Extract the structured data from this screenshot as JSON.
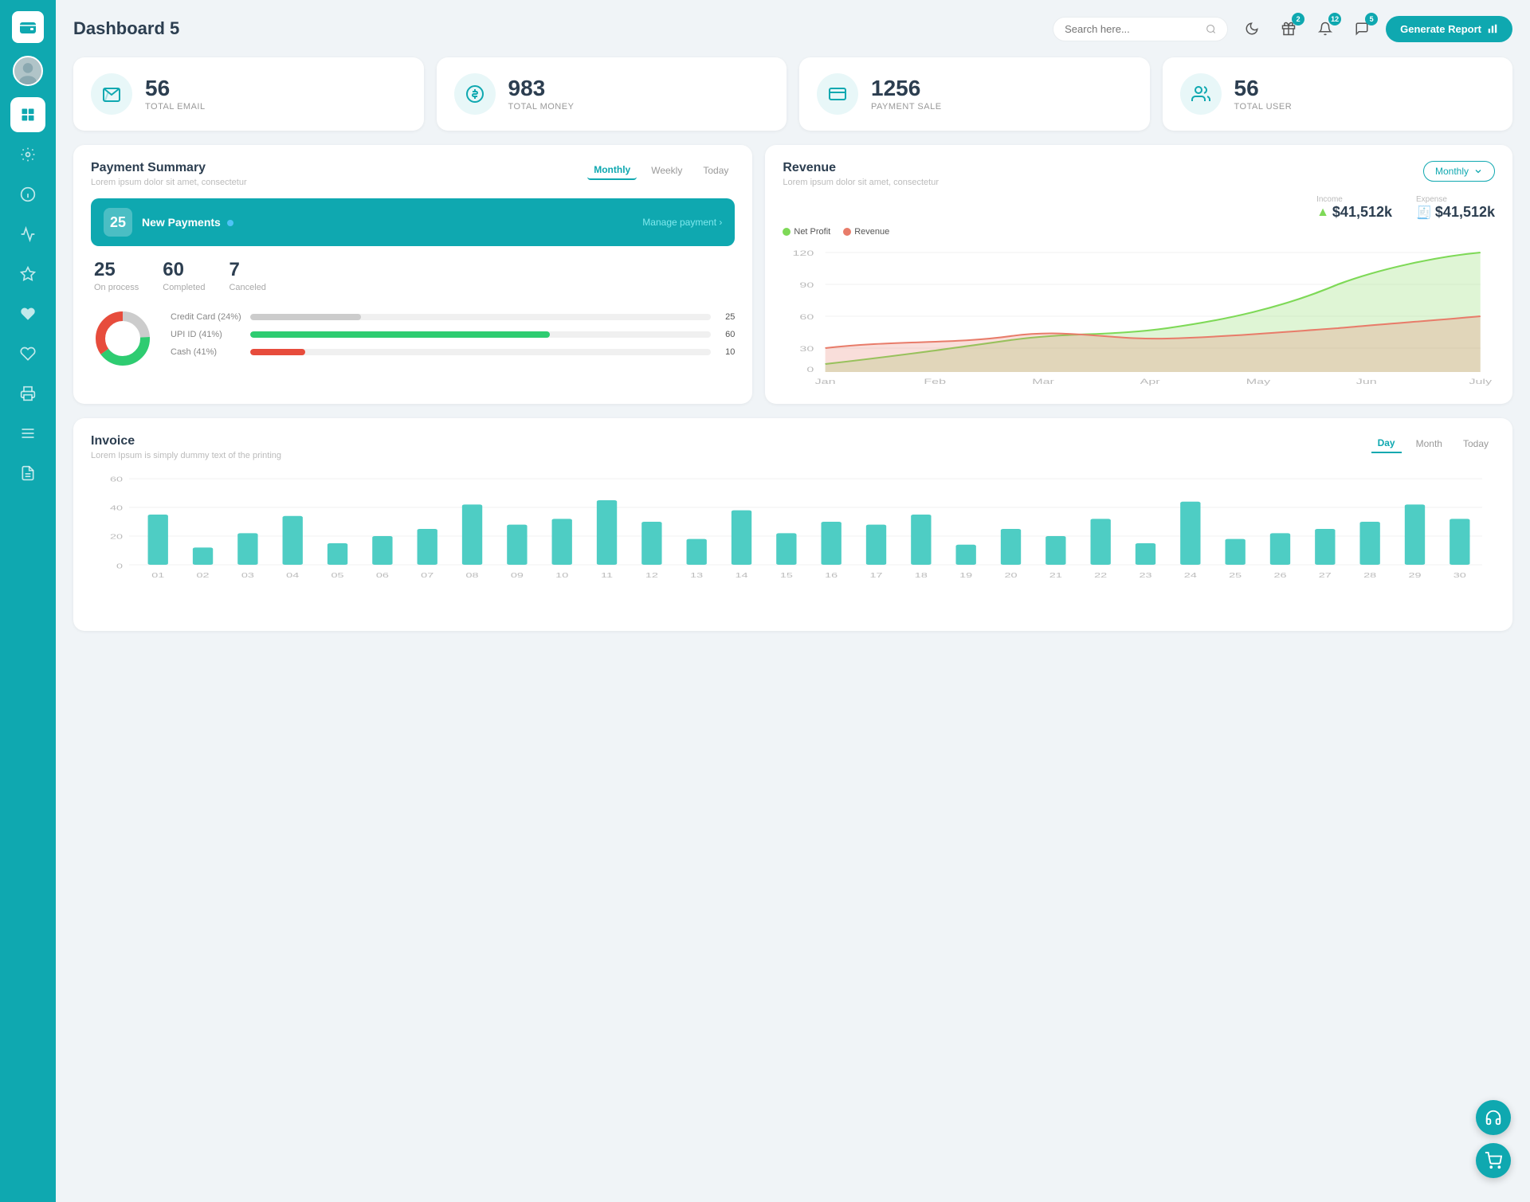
{
  "sidebar": {
    "logo_icon": "wallet",
    "items": [
      {
        "id": "dashboard",
        "icon": "⊞",
        "active": true
      },
      {
        "id": "settings",
        "icon": "⚙"
      },
      {
        "id": "info",
        "icon": "ℹ"
      },
      {
        "id": "chart",
        "icon": "📊"
      },
      {
        "id": "star",
        "icon": "★"
      },
      {
        "id": "heart",
        "icon": "♥"
      },
      {
        "id": "heart2",
        "icon": "♡"
      },
      {
        "id": "print",
        "icon": "🖨"
      },
      {
        "id": "list",
        "icon": "☰"
      },
      {
        "id": "doc",
        "icon": "📋"
      }
    ]
  },
  "header": {
    "title": "Dashboard 5",
    "search_placeholder": "Search here...",
    "badge_gift": "2",
    "badge_bell": "12",
    "badge_chat": "5",
    "generate_btn": "Generate Report"
  },
  "stat_cards": [
    {
      "id": "email",
      "number": "56",
      "label": "TOTAL EMAIL",
      "icon": "📋"
    },
    {
      "id": "money",
      "number": "983",
      "label": "TOTAL MONEY",
      "icon": "$"
    },
    {
      "id": "payment",
      "number": "1256",
      "label": "PAYMENT SALE",
      "icon": "💳"
    },
    {
      "id": "user",
      "number": "56",
      "label": "TOTAL USER",
      "icon": "👥"
    }
  ],
  "payment_summary": {
    "title": "Payment Summary",
    "subtitle": "Lorem ipsum dolor sit amet, consectetur",
    "tabs": [
      "Monthly",
      "Weekly",
      "Today"
    ],
    "active_tab": "Monthly",
    "new_payments_count": "25",
    "new_payments_label": "New Payments",
    "manage_link": "Manage payment",
    "on_process": {
      "value": "25",
      "label": "On process"
    },
    "completed": {
      "value": "60",
      "label": "Completed"
    },
    "canceled": {
      "value": "7",
      "label": "Canceled"
    },
    "methods": [
      {
        "label": "Credit Card (24%)",
        "pct": 24,
        "color": "#ccc",
        "value": 25
      },
      {
        "label": "UPI ID (41%)",
        "pct": 41,
        "color": "#2ecc71",
        "value": 60
      },
      {
        "label": "Cash (41%)",
        "pct": 35,
        "color": "#e74c3c",
        "value": 10
      }
    ]
  },
  "revenue": {
    "title": "Revenue",
    "subtitle": "Lorem ipsum dolor sit amet, consectetur",
    "filter": "Monthly",
    "income_label": "Income",
    "income_value": "$41,512k",
    "expense_label": "Expense",
    "expense_value": "$41,512k",
    "legend": [
      {
        "label": "Net Profit",
        "color": "#7ed957"
      },
      {
        "label": "Revenue",
        "color": "#e87c6a"
      }
    ],
    "x_labels": [
      "Jan",
      "Feb",
      "Mar",
      "Apr",
      "May",
      "Jun",
      "July"
    ],
    "y_labels": [
      "0",
      "30",
      "60",
      "90",
      "120"
    ]
  },
  "invoice": {
    "title": "Invoice",
    "subtitle": "Lorem Ipsum is simply dummy text of the printing",
    "tabs": [
      "Day",
      "Month",
      "Today"
    ],
    "active_tab": "Day",
    "x_labels": [
      "01",
      "02",
      "03",
      "04",
      "05",
      "06",
      "07",
      "08",
      "09",
      "10",
      "11",
      "12",
      "13",
      "14",
      "15",
      "16",
      "17",
      "18",
      "19",
      "20",
      "21",
      "22",
      "23",
      "24",
      "25",
      "26",
      "27",
      "28",
      "29",
      "30"
    ],
    "y_labels": [
      "0",
      "20",
      "40",
      "60"
    ],
    "bars": [
      35,
      12,
      22,
      34,
      15,
      20,
      25,
      42,
      28,
      32,
      45,
      30,
      18,
      38,
      22,
      30,
      28,
      35,
      14,
      25,
      20,
      32,
      15,
      44,
      18,
      22,
      25,
      30,
      42,
      32
    ]
  }
}
